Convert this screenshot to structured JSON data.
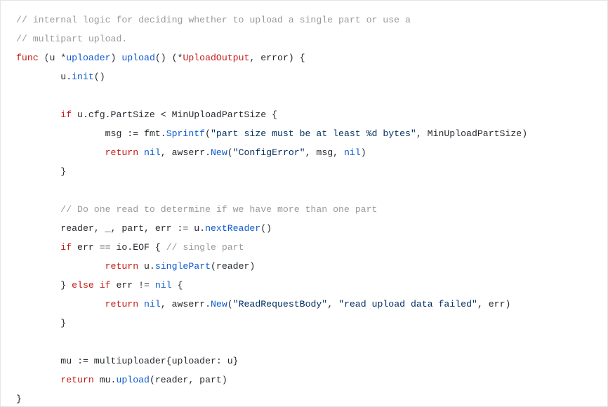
{
  "code": {
    "comment1": "// internal logic for deciding whether to upload a single part or use a",
    "comment2": "// multipart upload.",
    "kw_func": "func",
    "recv_open": " (u *",
    "type_uploader": "uploader",
    "recv_close": ") ",
    "fn_upload": "upload",
    "sig_rest": "() (*",
    "type_UploadOutput": "UploadOutput",
    "sig_after": ", error) {",
    "init_prefix": "        u.",
    "fn_init": "init",
    "init_suffix": "()",
    "blank": "",
    "if1_kw": "        if",
    "if1_cond": " u.cfg.PartSize < MinUploadPartSize {",
    "msg_lhs": "                msg ",
    "msg_op": ":=",
    "msg_mid": " fmt.",
    "fn_Sprintf": "Sprintf",
    "msg_open": "(",
    "str_partsize": "\"part size must be at least %d bytes\"",
    "msg_after": ", MinUploadPartSize)",
    "ret1_kw": "                return",
    "ret1_sp": " ",
    "nil1": "nil",
    "ret1_mid": ", awserr.",
    "fn_New1": "New",
    "ret1_open": "(",
    "str_ConfigError": "\"ConfigError\"",
    "ret1_mid2": ", msg, ",
    "nil1b": "nil",
    "ret1_close": ")",
    "brace_close1": "        }",
    "comment3": "        // Do one read to determine if we have more than one part",
    "reader_lhs": "        reader, _, part, err ",
    "reader_op": ":=",
    "reader_mid": " u.",
    "fn_nextReader": "nextReader",
    "reader_suffix": "()",
    "if2_kw": "        if",
    "if2_cond": " err == io.EOF { ",
    "comment4": "// single part",
    "ret2_kw": "                return",
    "ret2_mid": " u.",
    "fn_singlePart": "singlePart",
    "ret2_suffix": "(reader)",
    "else_line_a": "        } ",
    "else_kw1": "else",
    "else_sp": " ",
    "else_kw2": "if",
    "else_cond": " err != ",
    "nil2": "nil",
    "else_brace": " {",
    "ret3_kw": "                return",
    "ret3_sp": " ",
    "nil3": "nil",
    "ret3_mid": ", awserr.",
    "fn_New2": "New",
    "ret3_open": "(",
    "str_ReadRequestBody": "\"ReadRequestBody\"",
    "ret3_mid2": ", ",
    "str_readfail": "\"read upload data failed\"",
    "ret3_mid3": ", err)",
    "brace_close2": "        }",
    "mu_lhs": "        mu ",
    "mu_op": ":=",
    "mu_rhs": " multiuploader{uploader: u}",
    "ret4_kw": "        return",
    "ret4_mid": " mu.",
    "fn_upload2": "upload",
    "ret4_suffix": "(reader, part)",
    "brace_final": "}"
  }
}
